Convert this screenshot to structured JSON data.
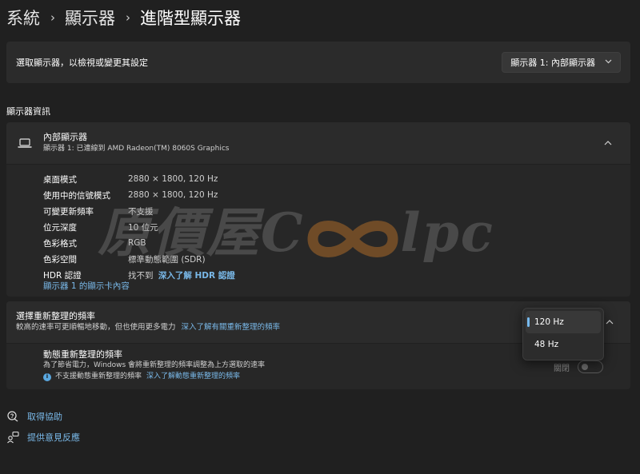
{
  "breadcrumb": {
    "items": [
      "系統",
      "顯示器"
    ],
    "current": "進階型顯示器",
    "separator": "›"
  },
  "select_display": {
    "label": "選取顯示器，以檢視或變更其設定",
    "value": "顯示器 1: 內部顯示器"
  },
  "section_title": "顯示器資訊",
  "display": {
    "name": "內部顯示器",
    "subtitle": "顯示器 1: 已連線到 AMD Radeon(TM) 8060S Graphics",
    "icon": "laptop-icon",
    "info": [
      {
        "key": "桌面模式",
        "value": "2880 × 1800, 120 Hz"
      },
      {
        "key": "使用中的信號模式",
        "value": "2880 × 1800, 120 Hz"
      },
      {
        "key": "可變更新頻率",
        "value": "不支援"
      },
      {
        "key": "位元深度",
        "value": "10 位元"
      },
      {
        "key": "色彩格式",
        "value": "RGB"
      },
      {
        "key": "色彩空間",
        "value": "標準動態範圍 (SDR)"
      }
    ],
    "hdr": {
      "key": "HDR 認證",
      "value": "找不到",
      "link": "深入了解 HDR 認證"
    },
    "adapter_link": "顯示器 1 的顯示卡內容"
  },
  "refresh": {
    "title": "選擇重新整理的頻率",
    "desc": "較高的速率可更順暢地移動，但也使用更多電力",
    "link": "深入了解有關重新整理的頻率",
    "options": [
      "120 Hz",
      "48 Hz"
    ],
    "selected": "120 Hz"
  },
  "dynamic": {
    "title": "動態重新整理的頻率",
    "desc": "為了節省電力，Windows 會將重新整理的頻率調整為上方選取的速率",
    "note": "不支援動態重新整理的頻率",
    "note_link": "深入了解動態重新整理的頻率",
    "toggle_label": "關閉",
    "toggle_on": false
  },
  "footer": {
    "help": "取得協助",
    "feedback": "提供意見反應"
  },
  "watermark": {
    "text_left": "原價屋",
    "text_c": "C",
    "text_right": "lpc"
  },
  "colors": {
    "background": "#202020",
    "card": "#2b2b2b",
    "link": "#79b8e8",
    "accent": "#76b9ed"
  }
}
